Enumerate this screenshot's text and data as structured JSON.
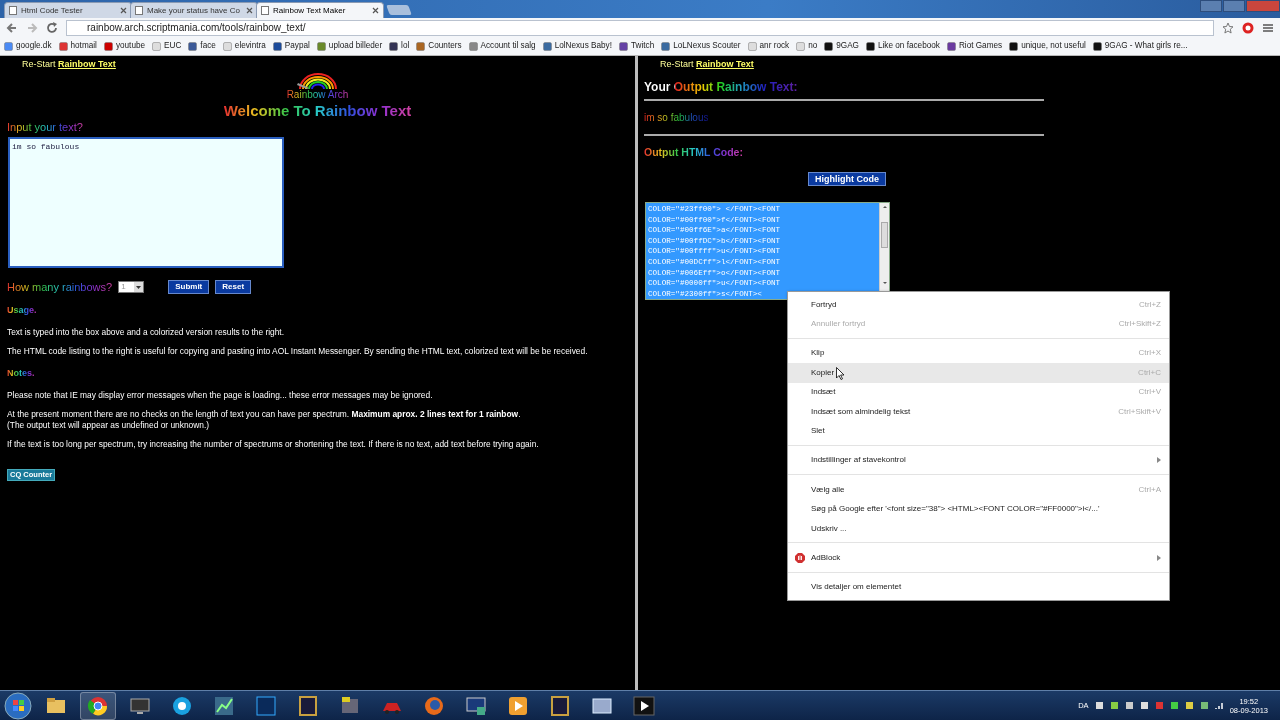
{
  "browser": {
    "tabs": [
      {
        "title": "Html Code Tester",
        "selected": false
      },
      {
        "title": "Make your status have Co",
        "selected": false
      },
      {
        "title": "Rainbow Text Maker",
        "selected": true
      }
    ],
    "address": "rainbow.arch.scriptmania.com/tools/rainbow_text/",
    "bookmarks": [
      "google.dk",
      "hotmail",
      "youtube",
      "EUC",
      "face",
      "elevintra",
      "Paypal",
      "upload billeder",
      "lol",
      "Counters",
      "Account til salg",
      "LolNexus Baby!",
      "Twitch",
      "LoLNexus Scouter",
      "anr rock",
      "no",
      "9GAG",
      "Like on facebook",
      "Riot Games",
      "unique, not useful",
      "9GAG - What girls re..."
    ]
  },
  "left_frame": {
    "restart_label": "Re-Start",
    "restart_link": "Rainbow Text",
    "logo_text": "Rainbow Arch",
    "heading": "Welcome To Rainbow Text",
    "input_label": "Input your text?",
    "input_value": "im so fabulous",
    "rainbows_label": "How many rainbows?",
    "rainbows_value": "1",
    "buttons": [
      "Submit",
      "Reset"
    ],
    "usage_heading": "Usage.",
    "usage": [
      [
        "Text is typed into the box above and a colorized version results to the right."
      ],
      [
        "The HTML code listing to the right is useful for copying and pasting into AOL Instant Messenger. By sending the HTML text, colorized text will be be received."
      ]
    ],
    "notes_heading": "Notes.",
    "notes": [
      [
        "Please note that IE may display error messages when the page is loading... these error messages may be ignored."
      ],
      [
        "At the present moment there are no checks on the length of text you can have per spectrum. **Maximum aprox. 2 lines text for 1 rainbow**.",
        "(The output text will appear as undefined or unknown.)"
      ],
      [
        "If the text is too long per spectrum, try increasing the number of spectrums or shortening the text. If there is no text, add text before trying again."
      ]
    ],
    "counter": "CQ Counter"
  },
  "right_frame": {
    "restart_label": "Re-Start",
    "restart_link": "Rainbow Text",
    "output_heading": "Your Output Rainbow Text:",
    "output_text": "im so fabulous",
    "code_heading": "Output HTML Code:",
    "highlight_button": "Highlight Code",
    "code_lines": [
      "COLOR=\"#23ff00\"> </FONT><FONT",
      "COLOR=\"#00ff00\">f</FONT><FONT",
      "COLOR=\"#00ff6E\">a</FONT><FONT",
      "COLOR=\"#00ffDC\">b</FONT><FONT",
      "COLOR=\"#00ffff\">u</FONT><FONT",
      "COLOR=\"#00DCff\">l</FONT><FONT",
      "COLOR=\"#006Eff\">o</FONT><FONT",
      "COLOR=\"#0000ff\">u</FONT><FONT",
      "COLOR=\"#2300ff\">s</FONT><"
    ]
  },
  "context_menu": {
    "groups": [
      [
        {
          "kind": "item",
          "label": "Fortryd",
          "shortcut": "Ctrl+Z",
          "disabled": false,
          "selected": false,
          "submenu": false
        },
        {
          "kind": "item",
          "label": "Annuller fortryd",
          "shortcut": "Ctrl+Skift+Z",
          "disabled": true,
          "selected": false,
          "submenu": false
        }
      ],
      [
        {
          "kind": "item",
          "label": "Klip",
          "shortcut": "Ctrl+X",
          "disabled": false,
          "selected": false,
          "submenu": false
        },
        {
          "kind": "item",
          "label": "Kopier",
          "shortcut": "Ctrl+C",
          "disabled": false,
          "selected": true,
          "submenu": false
        },
        {
          "kind": "item",
          "label": "Indsæt",
          "shortcut": "Ctrl+V",
          "disabled": false,
          "selected": false,
          "submenu": false
        },
        {
          "kind": "item",
          "label": "Indsæt som almindelig tekst",
          "shortcut": "Ctrl+Skift+V",
          "disabled": false,
          "selected": false,
          "submenu": false
        },
        {
          "kind": "item",
          "label": "Slet",
          "disabled": false,
          "selected": false,
          "submenu": false
        }
      ],
      [
        {
          "kind": "item",
          "label": "Indstillinger af stavekontrol",
          "disabled": false,
          "selected": false,
          "submenu": true
        }
      ],
      [
        {
          "kind": "item",
          "label": "Vælg alle",
          "shortcut": "Ctrl+A",
          "disabled": false,
          "selected": false,
          "submenu": false
        },
        {
          "kind": "item",
          "label": "Søg på Google efter '<font size=\"38\"> <HTML><FONT COLOR=\"#FF0000\">i</...'",
          "disabled": false,
          "selected": false,
          "submenu": false
        },
        {
          "kind": "item",
          "label": "Udskriv ...",
          "disabled": false,
          "selected": false,
          "submenu": false
        }
      ],
      [
        {
          "kind": "extension",
          "label": "AdBlock",
          "disabled": false,
          "selected": false,
          "submenu": true
        }
      ],
      [
        {
          "kind": "item",
          "label": "Vis detaljer om elementet",
          "disabled": false,
          "selected": false,
          "submenu": false
        }
      ]
    ]
  },
  "taskbar": {
    "language": "DA",
    "time": "19:52",
    "date": "08-09-2013"
  }
}
